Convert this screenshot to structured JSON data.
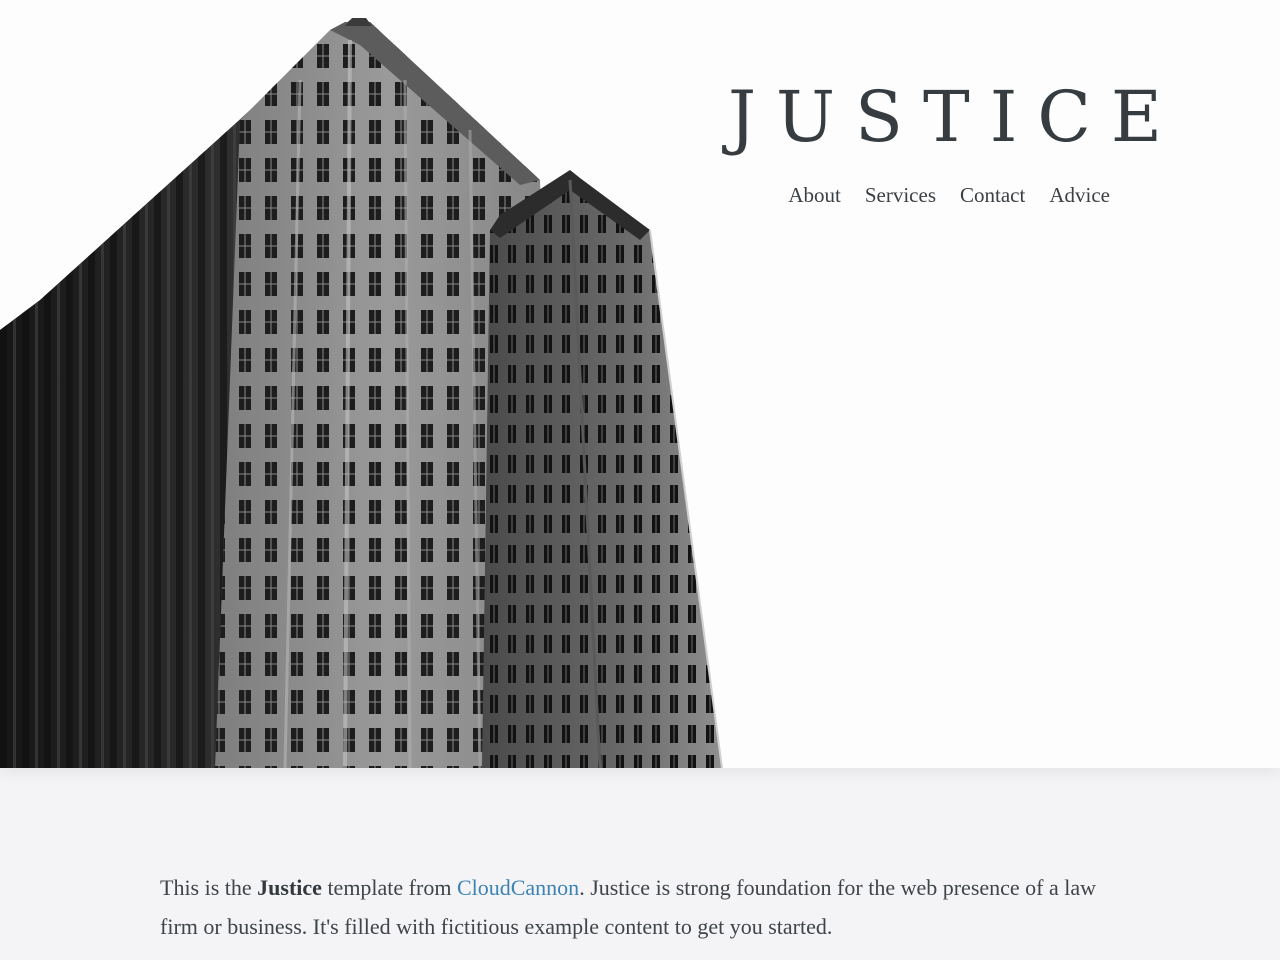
{
  "site": {
    "title": "JUSTICE",
    "nav": [
      "About",
      "Services",
      "Contact",
      "Advice"
    ]
  },
  "hero": {
    "image_description": "black and white photo of tall buildings"
  },
  "intro": {
    "part1": "This is the ",
    "brand": "Justice",
    "part2": " template from ",
    "link": "CloudCannon",
    "part3": ". Justice is strong foundation for the web presence of a law firm or business. It's filled with fictitious example content to get you started."
  },
  "colors": {
    "title": "#363c40",
    "text": "#3f4448",
    "link": "#3b82b5",
    "background": "#f4f4f6",
    "hero_background": "#fdfdfd"
  }
}
